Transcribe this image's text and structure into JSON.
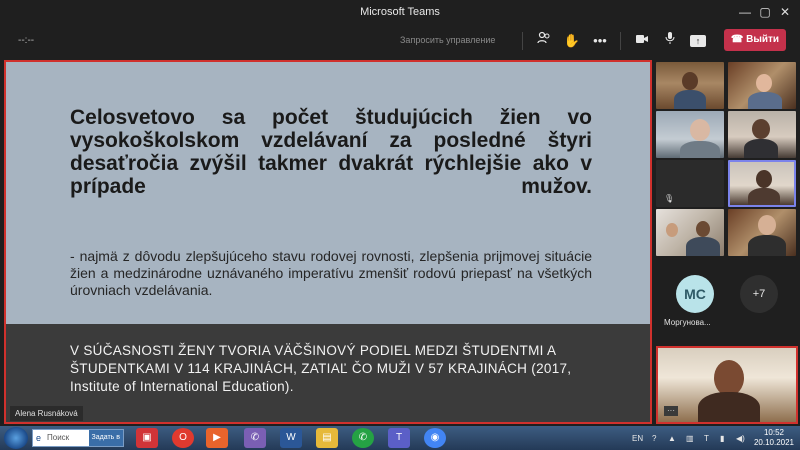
{
  "window": {
    "title": "Microsoft Teams"
  },
  "toolbar": {
    "timer": "--:--",
    "request_control": "Запросить управление",
    "leave_label": "Выйти",
    "icons": [
      "people-icon",
      "raise-hand-icon",
      "more-icon",
      "camera-icon",
      "mic-icon",
      "share-icon",
      "phone-icon"
    ]
  },
  "slide": {
    "heading": "Celosvetovo sa počet študujúcich žien vo vysokoškolskom vzdelávaní za posledné štyri desaťročia zvýšil takmer dvakrát rýchlejšie ako v prípade mužov.",
    "body": "- najmä z dôvodu zlepšujúceho stavu rodovej rovnosti, zlepšenia prijmovej situácie žien a medzinárodne uznávaného imperatívu zmenšiť rodovú priepasť na všetkých úrovniach vzdelávania.",
    "footer": "V SÚČASNOSTI ŽENY TVORIA VÄČŠINOVÝ PODIEL MEDZI ŠTUDENTMI A ŠTUDENTKAMI V 114 KRAJINÁCH, ZATIAĽ ČO MUŽI V 57 KRAJINÁCH (2017, Institute of International Education)."
  },
  "presenter": {
    "name": "Alena Rusnáková"
  },
  "participants": {
    "avatar_initials": "МС",
    "avatar_name": "Моргунова...",
    "more_count": "+7"
  },
  "taskbar": {
    "search_placeholder": "Поиск",
    "search_tag": "Задать в",
    "language": "EN",
    "time": "10:52",
    "date": "20.10.2021"
  },
  "colors": {
    "leave": "#c4314b",
    "accent": "#d0312d",
    "slide_bg": "#a7b4c1",
    "slide_dark": "#3b3b3b"
  }
}
